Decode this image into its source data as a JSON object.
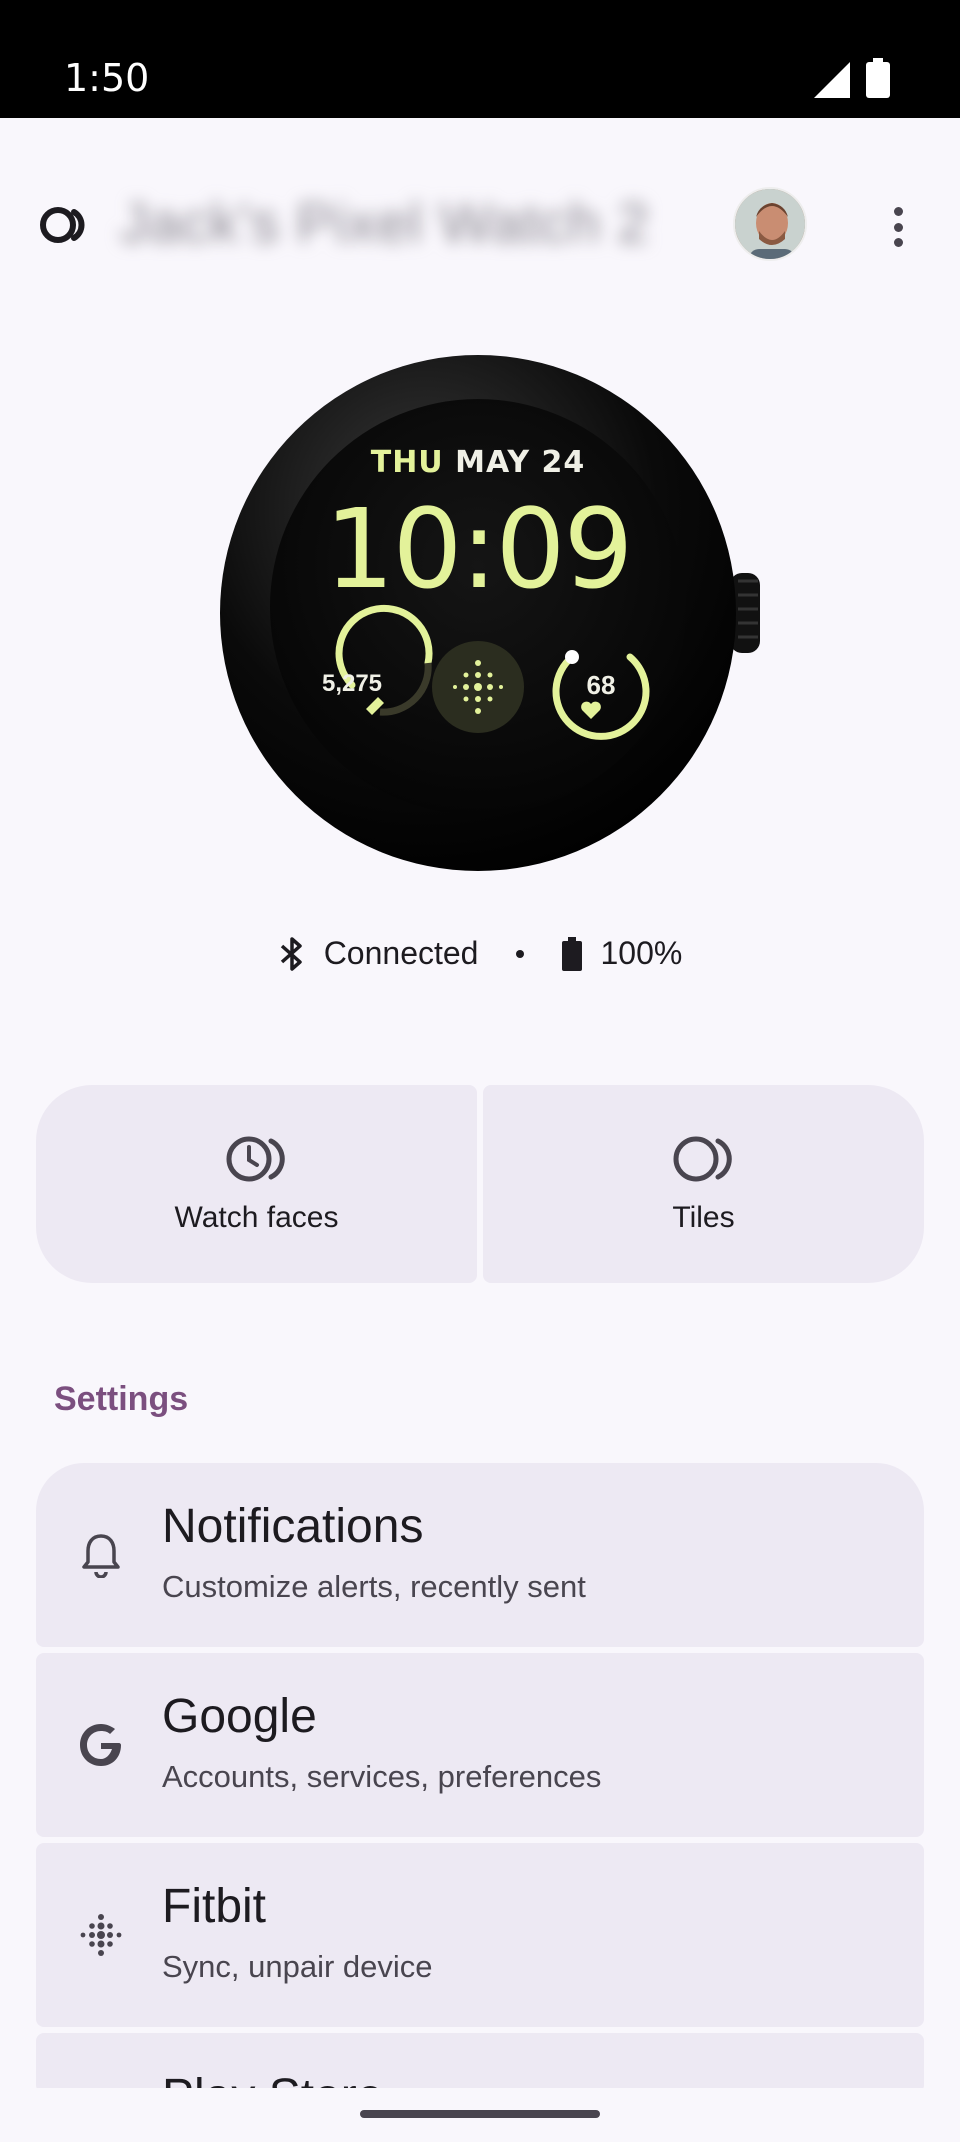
{
  "status_bar": {
    "time": "1:50"
  },
  "header": {
    "device_name": "Jack's Pixel Watch 2"
  },
  "watch": {
    "day": "THU",
    "date": "MAY 24",
    "time": "10:09",
    "steps": "5,275",
    "heart_rate": "68"
  },
  "connection": {
    "status": "Connected",
    "battery": "100%"
  },
  "tiles": [
    {
      "label": "Watch faces",
      "icon": "watch-face-icon"
    },
    {
      "label": "Tiles",
      "icon": "tiles-icon"
    }
  ],
  "settings": {
    "title": "Settings",
    "items": [
      {
        "title": "Notifications",
        "subtitle": "Customize alerts, recently sent",
        "icon": "bell-icon"
      },
      {
        "title": "Google",
        "subtitle": "Accounts, services, preferences",
        "icon": "google-icon"
      },
      {
        "title": "Fitbit",
        "subtitle": "Sync, unpair device",
        "icon": "fitbit-icon"
      },
      {
        "title": "Play Store",
        "icon": "play-store-icon"
      }
    ]
  },
  "colors": {
    "accent": "#7b4f7f",
    "card": "#ede9f3",
    "watch_text": "#e3f29a"
  }
}
